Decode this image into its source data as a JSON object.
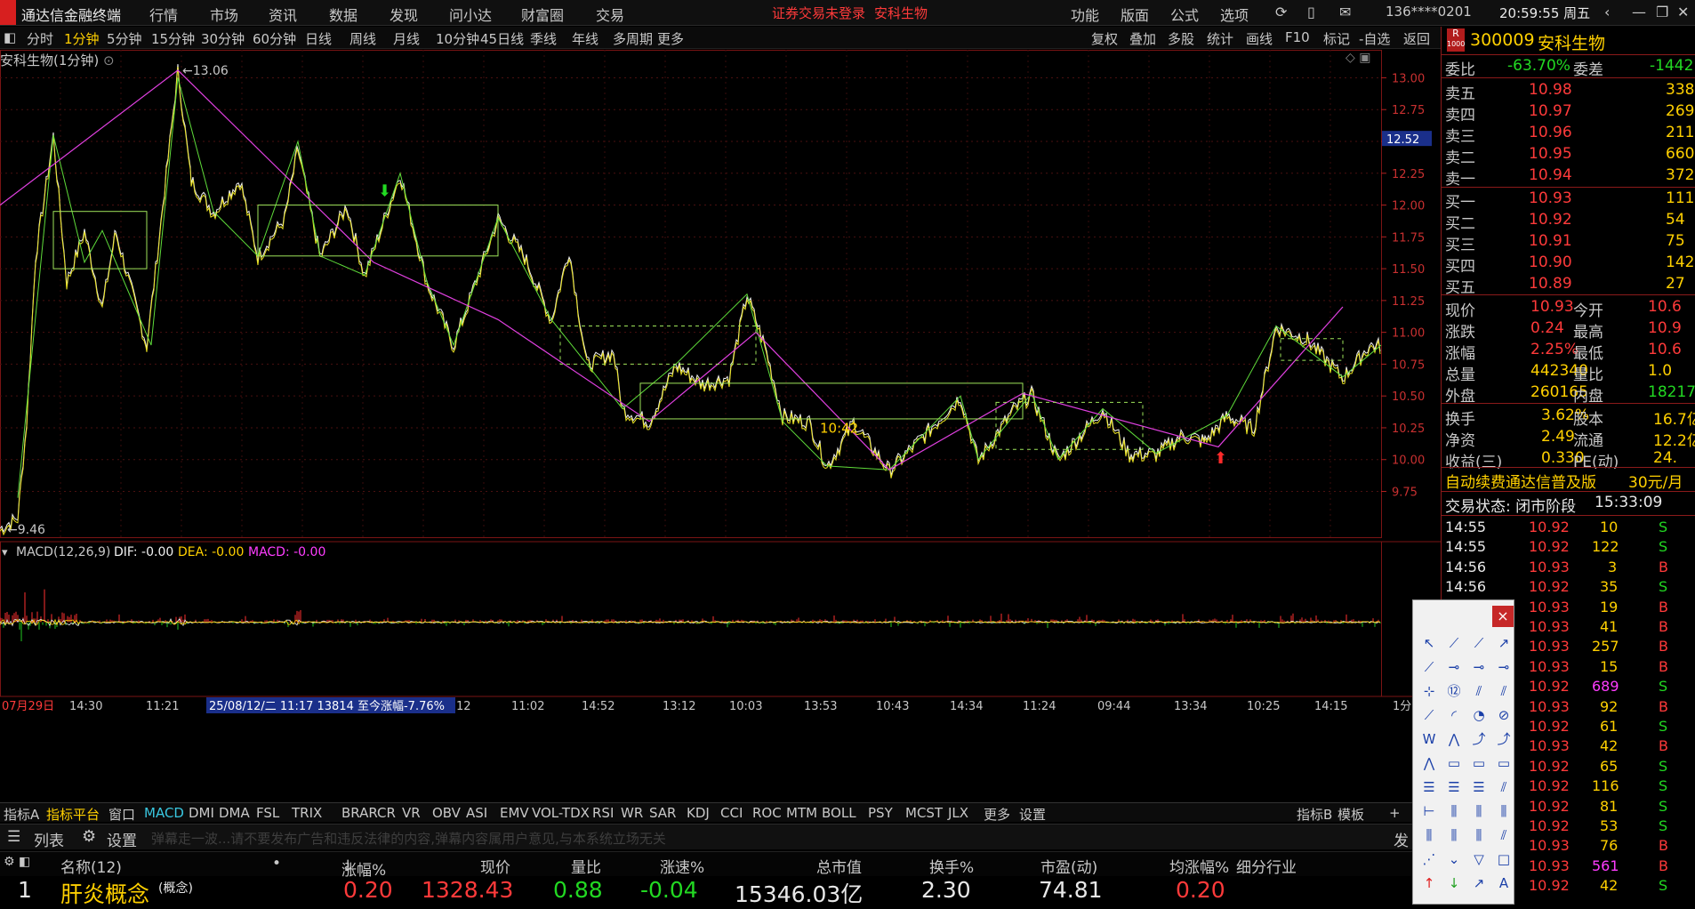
{
  "app": {
    "title": "通达信金融终端",
    "menu": [
      "行情",
      "市场",
      "资讯",
      "数据",
      "发现",
      "问小达",
      "财富圈",
      "交易"
    ],
    "notice": "证券交易未登录",
    "stock_short": "安科生物",
    "right_menu": [
      "功能",
      "版面",
      "公式",
      "选项"
    ],
    "account": "136****0201",
    "clock": "20:59:55 周五"
  },
  "periods": [
    "分时",
    "1分钟",
    "5分钟",
    "15分钟",
    "30分钟",
    "60分钟",
    "日线",
    "周线",
    "月线",
    "10分钟",
    "45日线",
    "季线",
    "年线",
    "多周期",
    "更多"
  ],
  "active_period": "1分钟",
  "tools": [
    "复权",
    "叠加",
    "多股",
    "统计",
    "画线",
    "F10",
    "标记",
    "-自选",
    "返回"
  ],
  "chart": {
    "title": "安科生物(1分钟)",
    "high_label": "13.06",
    "low_label": "9.46",
    "last_price": "12.52",
    "y_ticks": [
      "13.00",
      "12.75",
      "12.50",
      "12.25",
      "12.00",
      "11.75",
      "11.50",
      "11.25",
      "11.00",
      "10.75",
      "10.50",
      "10.25",
      "10.00",
      "9.75"
    ],
    "box_text": "10:42"
  },
  "macd": {
    "name": "MACD(12,26,9)",
    "dif": "DIF: -0.00",
    "dea": "DEA: -0.00",
    "macd": "MACD: -0.00"
  },
  "x_axis": {
    "labels": [
      "07月29日",
      "14:30",
      "11:21",
      "25/08/12/二 11:17 13814 至今涨幅-7.76%",
      "12",
      "11:02",
      "14:52",
      "13:12",
      "10:03",
      "13:53",
      "10:43",
      "14:34",
      "11:24",
      "09:44",
      "13:34",
      "10:25",
      "14:15"
    ],
    "end": "1分"
  },
  "indicators": [
    "指标A",
    "指标平台",
    "窗口",
    "MACD",
    "DMI",
    "DMA",
    "FSL",
    "TRIX",
    "BRAR",
    "CR",
    "VR",
    "OBV",
    "ASI",
    "EMV",
    "VOL-TDX",
    "RSI",
    "WR",
    "SAR",
    "KDJ",
    "CCI",
    "ROC",
    "MTM",
    "BOLL",
    "PSY",
    "MCST",
    "JLX",
    "更多",
    "设置"
  ],
  "indicators_right": [
    "指标B",
    "模板",
    "+"
  ],
  "list": {
    "tab": "列表",
    "settings": "设置",
    "danmu": "弹幕走一波...请不要发布广告和违反法律的内容,弹幕内容属用户意见,与本系统立场无关",
    "post": "发"
  },
  "columns": {
    "name": "名称(12)",
    "dot": "•",
    "chg": "涨幅%",
    "price": "现价",
    "vr": "量比",
    "speed": "涨速%",
    "mv": "总市值",
    "turn": "换手%",
    "pe": "市盈(动)",
    "avg": "均涨幅%",
    "ind": "细分行业"
  },
  "row1": {
    "no": "1",
    "name": "肝炎概念",
    "tag": "(概念)",
    "chg": "0.20",
    "price": "1328.43",
    "vr": "0.88",
    "speed": "-0.04",
    "mv": "15346.03亿",
    "turn": "2.30",
    "pe": "74.81",
    "avg": "0.20"
  },
  "quote": {
    "code": "300009",
    "name": "安科生物",
    "badge": "R",
    "badge2": "1000",
    "wb_label": "委比",
    "wb": "-63.70%",
    "wc_label": "委差",
    "wc": "-1442",
    "asks": [
      {
        "l": "卖五",
        "p": "10.98",
        "v": "338"
      },
      {
        "l": "卖四",
        "p": "10.97",
        "v": "269"
      },
      {
        "l": "卖三",
        "p": "10.96",
        "v": "211"
      },
      {
        "l": "卖二",
        "p": "10.95",
        "v": "660"
      },
      {
        "l": "卖一",
        "p": "10.94",
        "v": "372"
      }
    ],
    "bids": [
      {
        "l": "买一",
        "p": "10.93",
        "v": "111"
      },
      {
        "l": "买二",
        "p": "10.92",
        "v": "54"
      },
      {
        "l": "买三",
        "p": "10.91",
        "v": "75"
      },
      {
        "l": "买四",
        "p": "10.90",
        "v": "142"
      },
      {
        "l": "买五",
        "p": "10.89",
        "v": "27"
      }
    ],
    "stats": [
      [
        "现价",
        "10.93",
        "今开",
        "10.6"
      ],
      [
        "涨跌",
        "0.24",
        "最高",
        "10.9"
      ],
      [
        "涨幅",
        "2.25%",
        "最低",
        "10.6"
      ],
      [
        "总量",
        "442340",
        "量比",
        "1.0"
      ],
      [
        "外盘",
        "260165",
        "内盘",
        "18217"
      ]
    ],
    "stats2": [
      [
        "换手",
        "3.62%",
        "股本",
        "16.7亿"
      ],
      [
        "净资",
        "2.49",
        "流通",
        "12.2亿"
      ],
      [
        "收益(三)",
        "0.330",
        "PE(动)",
        "24."
      ]
    ],
    "promo": "自动续费通达信普及版",
    "promo_price": "30元/月",
    "status": "交易状态: 闭市阶段",
    "status_time": "15:33:09"
  },
  "ticks": [
    [
      "14:55",
      "10.92",
      "10",
      "S"
    ],
    [
      "14:55",
      "10.92",
      "122",
      "S"
    ],
    [
      "14:56",
      "10.93",
      "3",
      "B"
    ],
    [
      "14:56",
      "10.92",
      "35",
      "S"
    ],
    [
      "",
      "10.93",
      "19",
      "B"
    ],
    [
      "",
      "10.93",
      "41",
      "B"
    ],
    [
      "",
      "10.93",
      "257",
      "B"
    ],
    [
      "",
      "10.93",
      "15",
      "B"
    ],
    [
      "",
      "10.92",
      "689",
      "S"
    ],
    [
      "",
      "10.93",
      "92",
      "B"
    ],
    [
      "",
      "10.92",
      "61",
      "S"
    ],
    [
      "",
      "10.93",
      "42",
      "B"
    ],
    [
      "",
      "10.92",
      "65",
      "S"
    ],
    [
      "",
      "10.92",
      "116",
      "S"
    ],
    [
      "",
      "10.92",
      "81",
      "S"
    ],
    [
      "",
      "10.92",
      "53",
      "S"
    ],
    [
      "",
      "10.93",
      "76",
      "B"
    ],
    [
      "",
      "10.93",
      "561",
      "B"
    ],
    [
      "",
      "10.92",
      "42",
      "S"
    ]
  ],
  "toolbox": {
    "close": "×"
  },
  "colors": {
    "up": "#ff3a3a",
    "down": "#22d822",
    "accent": "#ffd000",
    "border": "#8b1a1a"
  }
}
